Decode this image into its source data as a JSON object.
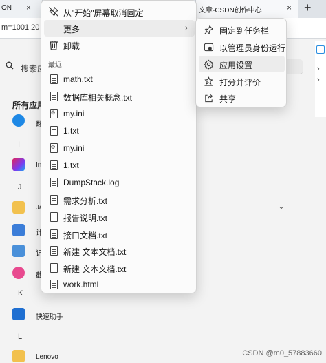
{
  "browser": {
    "left_tab_text": "ON",
    "left_tab_close": "×",
    "right_tab_text": "文章-CSDN创作中心",
    "right_tab_close": "×",
    "new_tab": "+",
    "address_fragment": "m=1001.20"
  },
  "start_panel": {
    "search_placeholder": "搜索应",
    "all_apps_title": "所有应用",
    "letters": [
      "I",
      "J",
      "K",
      "L"
    ],
    "apps": [
      {
        "label": "翻",
        "icon": "app-blue-person-icon",
        "color": "#1e88e5"
      },
      {
        "label": "In",
        "icon": "app-intellij-icon",
        "color": "#e0245e"
      },
      {
        "label": "Ja",
        "icon": "folder-icon",
        "color": "#f2c14e"
      },
      {
        "label": "计",
        "icon": "calculator-icon",
        "color": "#3b7dd8"
      },
      {
        "label": "记",
        "icon": "notepad-icon",
        "color": "#4a90d9"
      },
      {
        "label": "截",
        "icon": "snipping-icon",
        "color": "#e84a8f"
      },
      {
        "label": "快速助手",
        "icon": "quick-assist-icon",
        "color": "#1f6fd1"
      },
      {
        "label": "Lenovo",
        "icon": "folder-icon",
        "color": "#f2c14e"
      }
    ],
    "expand_chevron": "⌄",
    "watermark": "CSDN @m0_57883660"
  },
  "context_menu": {
    "unpin_label": "从\"开始\"屏幕取消固定",
    "more_label": "更多",
    "more_arrow": "›",
    "uninstall_label": "卸载",
    "recent_label": "最近",
    "recent_items": [
      {
        "label": "math.txt",
        "icon": "doc"
      },
      {
        "label": "数据库相关概念.txt",
        "icon": "doc"
      },
      {
        "label": "my.ini",
        "icon": "gear-doc"
      },
      {
        "label": "1.txt",
        "icon": "doc"
      },
      {
        "label": "my.ini",
        "icon": "gear-doc"
      },
      {
        "label": "1.txt",
        "icon": "doc"
      },
      {
        "label": "DumpStack.log",
        "icon": "doc"
      },
      {
        "label": "需求分析.txt",
        "icon": "doc"
      },
      {
        "label": "报告说明.txt",
        "icon": "doc"
      },
      {
        "label": "接口文档.txt",
        "icon": "doc"
      },
      {
        "label": "新建 文本文档.txt",
        "icon": "doc"
      },
      {
        "label": "新建 文本文档.txt",
        "icon": "doc"
      },
      {
        "label": "work.html",
        "icon": "doc"
      }
    ]
  },
  "submenu": {
    "items": [
      {
        "label": "固定到任务栏",
        "icon": "pin-icon"
      },
      {
        "label": "以管理员身份运行",
        "icon": "admin-shield-icon"
      },
      {
        "label": "应用设置",
        "icon": "gear-icon"
      },
      {
        "label": "打分并评价",
        "icon": "rate-review-icon"
      },
      {
        "label": "共享",
        "icon": "share-icon"
      }
    ]
  }
}
